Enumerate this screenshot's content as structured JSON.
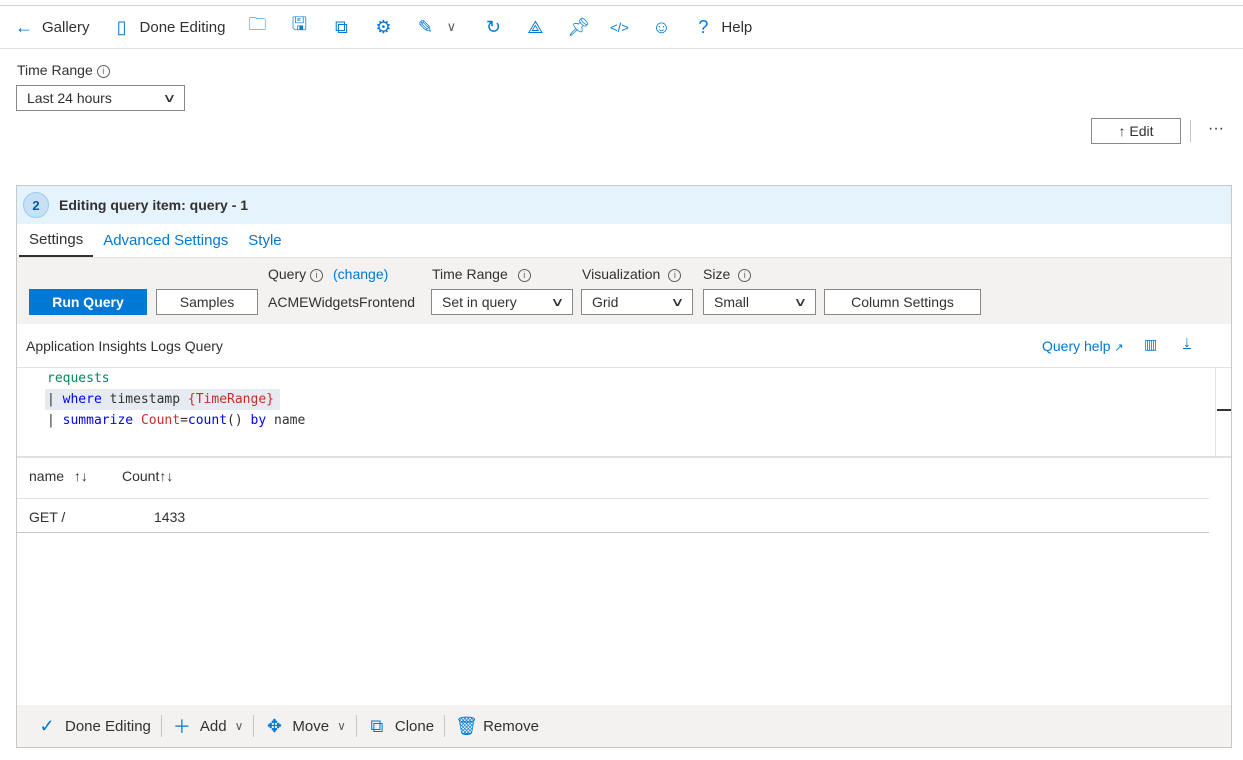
{
  "toolbar": {
    "gallery": "Gallery",
    "done_editing": "Done Editing",
    "help": "Help",
    "icons": [
      "open-folder-icon",
      "save-icon",
      "save-as-icon",
      "settings-gear-icon",
      "edit-pencil-icon",
      "chevron-down-icon",
      "refresh-icon",
      "share-icon",
      "pin-icon",
      "code-icon",
      "feedback-smiley-icon"
    ]
  },
  "time_range": {
    "label": "Time Range",
    "value": "Last 24 hours"
  },
  "edit_button": "↑ Edit",
  "more": "···",
  "panel": {
    "step": "2",
    "title": "Editing query item: query - 1",
    "tabs": [
      {
        "label": "Settings"
      },
      {
        "label": "Advanced Settings"
      },
      {
        "label": "Style"
      }
    ],
    "run_query": "Run Query",
    "samples": "Samples",
    "query_label": "Query",
    "change": "(change)",
    "resource": "ACMEWidgetsFrontend",
    "time_range_label": "Time Range",
    "time_range_value": "Set in query",
    "visualization_label": "Visualization",
    "visualization_value": "Grid",
    "size_label": "Size",
    "size_value": "Small",
    "column_settings": "Column Settings",
    "editor_title": "Application Insights Logs Query",
    "query_help": "Query help",
    "code": {
      "l1": "requests",
      "l2_pipe": "| ",
      "l2_kw": "where",
      "l2_mid": " timestamp ",
      "l2_var": "{TimeRange}",
      "l3_pipe": "| ",
      "l3_kw": "summarize",
      "l3_sp": " ",
      "l3_var": "Count",
      "l3_eq": "=",
      "l3_fn": "count",
      "l3_par": "() ",
      "l3_by": "by",
      "l3_end": " name"
    },
    "grid": {
      "columns": [
        "name",
        "Count"
      ],
      "rows": [
        [
          "GET /",
          "1433"
        ]
      ]
    },
    "footer": {
      "done_editing": "Done Editing",
      "add": "Add",
      "move": "Move",
      "clone": "Clone",
      "remove": "Remove"
    }
  },
  "colors": {
    "accent": "#0078d4",
    "header_bg": "#e5f3fd",
    "settings_bg": "#f3f2f1"
  }
}
